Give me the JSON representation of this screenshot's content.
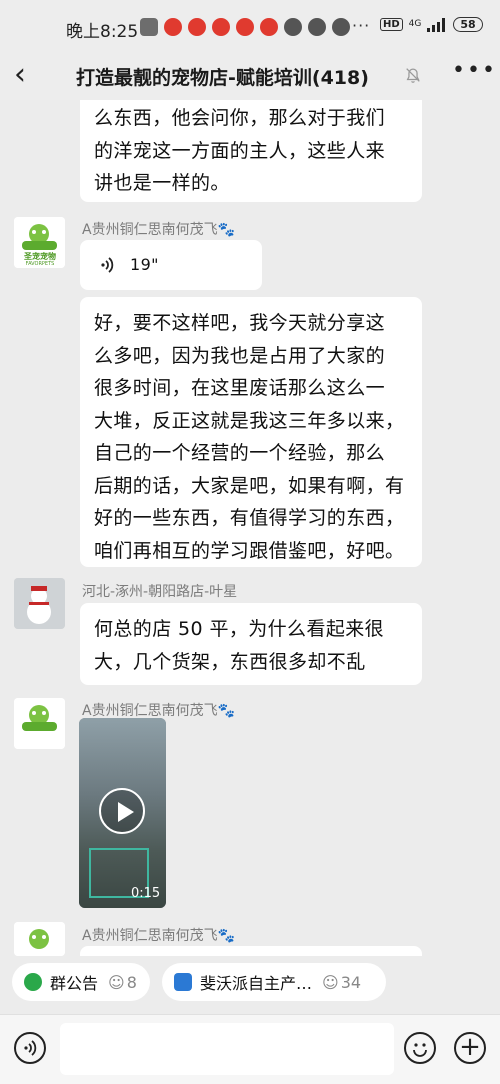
{
  "status_bar": {
    "time": "晚上8:25",
    "network": "4G",
    "hd": "HD",
    "battery": "58",
    "more": "···"
  },
  "header": {
    "back_icon": "chevron-left-icon",
    "title": "打造最靓的宠物店-赋能培训(418)",
    "mute_icon": "bell-off-icon",
    "more_icon": "more-dots-icon"
  },
  "messages": [
    {
      "type": "text",
      "lines": [
        "么东西，他会问你，那么对于我们",
        "的洋宠这一方面的主人，这些人来",
        "讲也是一样的。"
      ]
    },
    {
      "type": "voice",
      "sender": "A贵州铜仁思南何茂飞",
      "avatar_text": "圣宠宠物",
      "avatar_subtext": "FAVORPETS",
      "duration": "19\""
    },
    {
      "type": "text",
      "lines": [
        "好，要不这样吧，我今天就分享这",
        "么多吧，因为我也是占用了大家的",
        "很多时间，在这里废话那么这么一",
        "大堆，反正这就是我这三年多以来，",
        "自己的一个经营的一个经验，那么",
        "后期的话，大家是吧，如果有啊，有",
        "好的一些东西，有值得学习的东西，",
        "咱们再相互的学习跟借鉴吧，好吧。"
      ]
    },
    {
      "type": "text",
      "sender": "河北-涿州-朝阳路店-叶星",
      "lines": [
        "何总的店 50 平，为什么看起来很",
        "大，几个货架，东西很多却不乱"
      ]
    },
    {
      "type": "video",
      "sender": "A贵州铜仁思南何茂飞",
      "duration": "0:15"
    },
    {
      "type": "partial",
      "sender": "A贵州铜仁思南何茂飞"
    }
  ],
  "chips": [
    {
      "label": "群公告",
      "count": "8",
      "icon": "announcement-icon"
    },
    {
      "label": "斐沃派自主产…",
      "count": "34",
      "icon": "group-logo-icon"
    }
  ],
  "input_bar": {
    "voice_icon": "voice-icon",
    "emoji_icon": "emoji-icon",
    "plus_icon": "plus-icon",
    "plus_glyph": "+"
  },
  "colors": {
    "background": "#ececec",
    "bubble": "#ffffff",
    "sender": "#7c7c7c",
    "avatar_green": "#5cab2e"
  }
}
